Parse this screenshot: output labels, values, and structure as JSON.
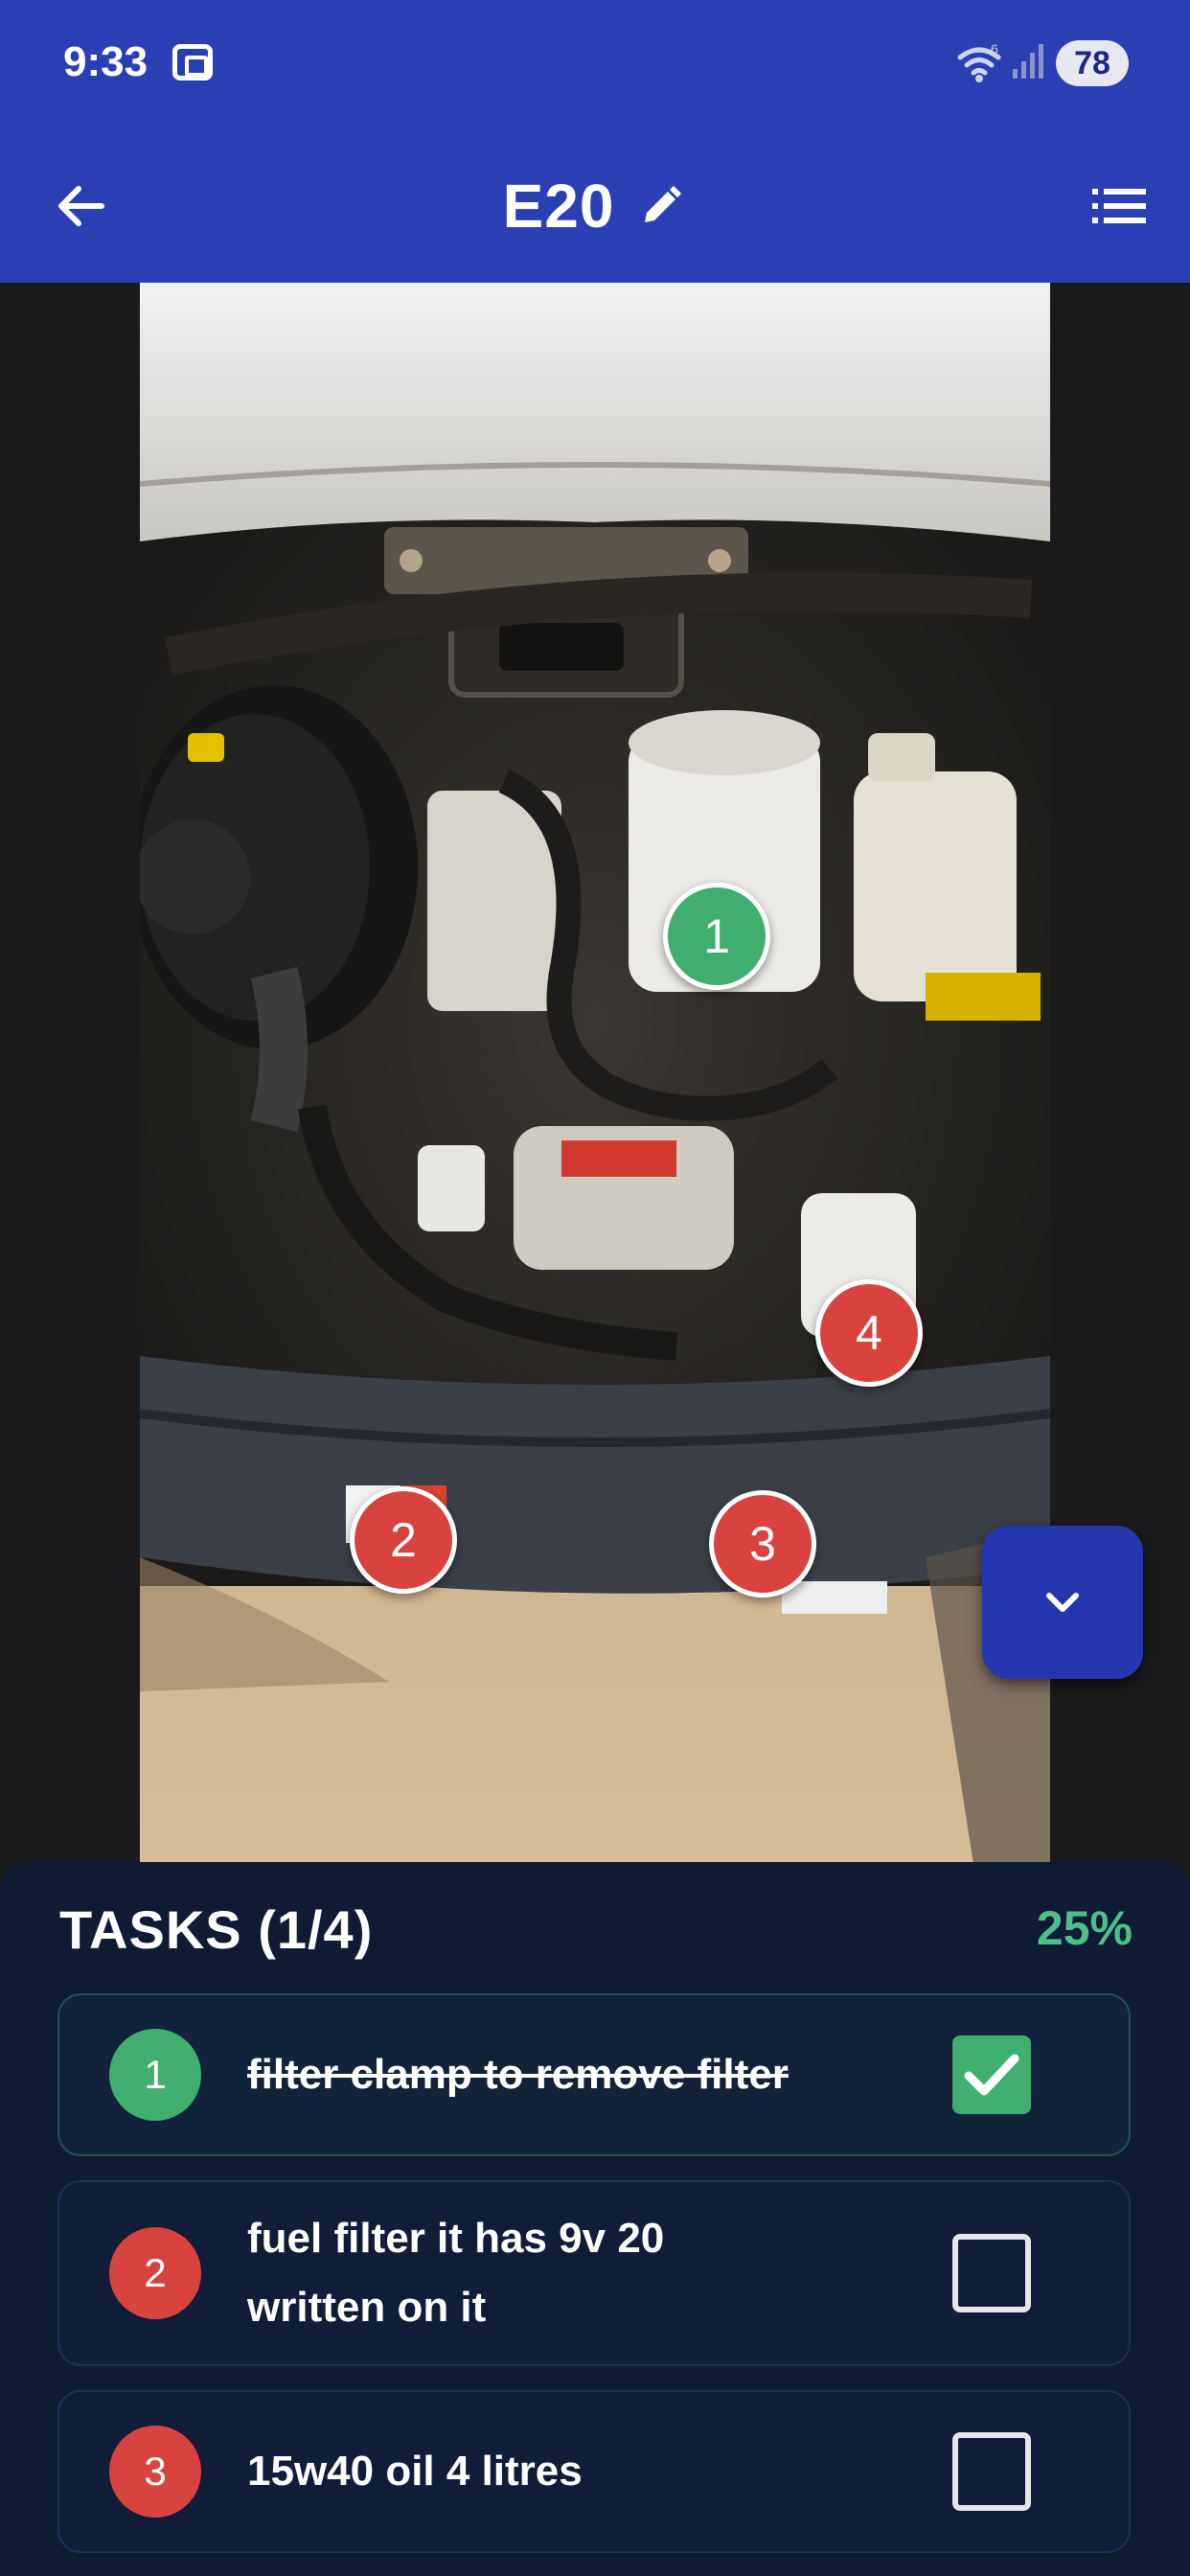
{
  "status_bar": {
    "time": "9:33",
    "battery": "78",
    "icons": [
      "screenshot-icon",
      "wifi-icon",
      "signal-icon"
    ]
  },
  "app_bar": {
    "title": "E20",
    "icons": [
      "back-arrow-icon",
      "pencil-icon",
      "list-icon"
    ]
  },
  "photo": {
    "markers": [
      {
        "label": "1",
        "status": "done"
      },
      {
        "label": "2",
        "status": "pending"
      },
      {
        "label": "3",
        "status": "pending"
      },
      {
        "label": "4",
        "status": "pending"
      }
    ],
    "collapse_icon": "chevron-down-icon"
  },
  "tasks": {
    "title": "TASKS (1/4)",
    "percent": "25%",
    "items": [
      {
        "num": "1",
        "text": "filter clamp to remove filter",
        "checked": true
      },
      {
        "num": "2",
        "text": "fuel filter it has 9v 20 written on it",
        "checked": false
      },
      {
        "num": "3",
        "text": "15w40 oil 4 litres",
        "checked": false
      }
    ]
  },
  "colors": {
    "primary": "#2a3fb3",
    "done_green": "#3fae6e",
    "pending_red": "#d9433f",
    "panel_bg": "#101a33",
    "percent_green": "#4cc08a"
  }
}
